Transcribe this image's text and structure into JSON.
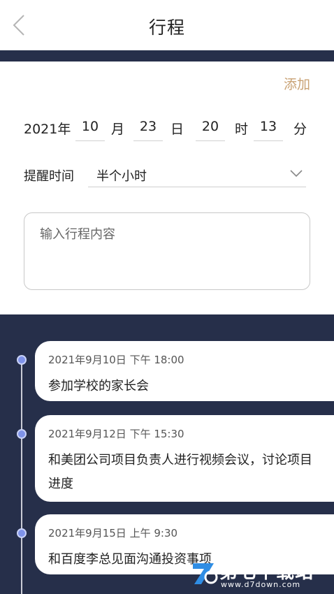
{
  "header": {
    "title": "行程"
  },
  "form": {
    "add_label": "添加",
    "date": {
      "year_label": "2021年",
      "month_value": "10",
      "month_label": "月",
      "day_value": "23",
      "day_label": "日",
      "hour_value": "20",
      "hour_label": "时",
      "minute_value": "13",
      "minute_label": "分"
    },
    "reminder": {
      "label": "提醒时间",
      "selected": "半个小时"
    },
    "content": {
      "placeholder": "输入行程内容",
      "value": ""
    }
  },
  "schedule": [
    {
      "time": "2021年9月10日  下午 18:00",
      "desc": "参加学校的家长会"
    },
    {
      "time": "2021年9月12日  下午 15:30",
      "desc": "和美团公司项目负责人进行视频会议，讨论项目进度"
    },
    {
      "time": "2021年9月15日  上午 9:30",
      "desc": "和百度李总见面沟通投资事项"
    }
  ],
  "watermark": {
    "text": "第七下载站",
    "url": "www.d7down.com"
  },
  "colors": {
    "accent": "#c9a274",
    "dark_bg": "#262f4a",
    "dot": "#7f93e9"
  }
}
